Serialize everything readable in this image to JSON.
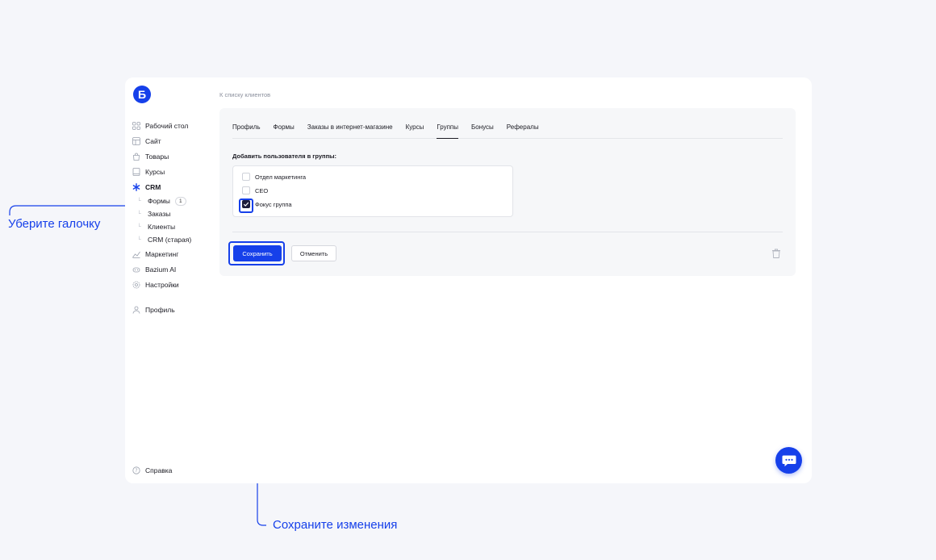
{
  "logo": {
    "letter": "Б"
  },
  "breadcrumb": "К списку клиентов",
  "sidebar": {
    "items": [
      {
        "label": "Рабочий стол",
        "icon": "grid-icon"
      },
      {
        "label": "Сайт",
        "icon": "layout-icon"
      },
      {
        "label": "Товары",
        "icon": "bag-icon"
      },
      {
        "label": "Курсы",
        "icon": "book-icon"
      },
      {
        "label": "CRM",
        "icon": "asterisk-icon"
      }
    ],
    "crm_sub": [
      {
        "label": "Формы",
        "badge": "1"
      },
      {
        "label": "Заказы"
      },
      {
        "label": "Клиенты"
      },
      {
        "label": "CRM (старая)"
      }
    ],
    "items2": [
      {
        "label": "Маркетинг",
        "icon": "chart-icon"
      },
      {
        "label": "Bazium AI",
        "icon": "ai-icon"
      },
      {
        "label": "Настройки",
        "icon": "gear-icon"
      }
    ],
    "profile": "Профиль",
    "help": "Справка"
  },
  "tabs": [
    "Профиль",
    "Формы",
    "Заказы в интернет-магазине",
    "Курсы",
    "Группы",
    "Бонусы",
    "Рефералы"
  ],
  "active_tab": "Группы",
  "groups_section": {
    "title": "Добавить пользователя в группы:",
    "groups": [
      {
        "label": "Отдел маркетинга",
        "checked": false
      },
      {
        "label": "CEO",
        "checked": false
      },
      {
        "label": "Фокус группа",
        "checked": true
      }
    ]
  },
  "actions": {
    "save": "Сохранить",
    "cancel": "Отменить"
  },
  "annotations": {
    "uncheck": "Уберите галочку",
    "save": "Сохраните изменения"
  },
  "colors": {
    "accent": "#1640ea",
    "background": "#f5f6fa",
    "panel": "#f6f7f9"
  }
}
